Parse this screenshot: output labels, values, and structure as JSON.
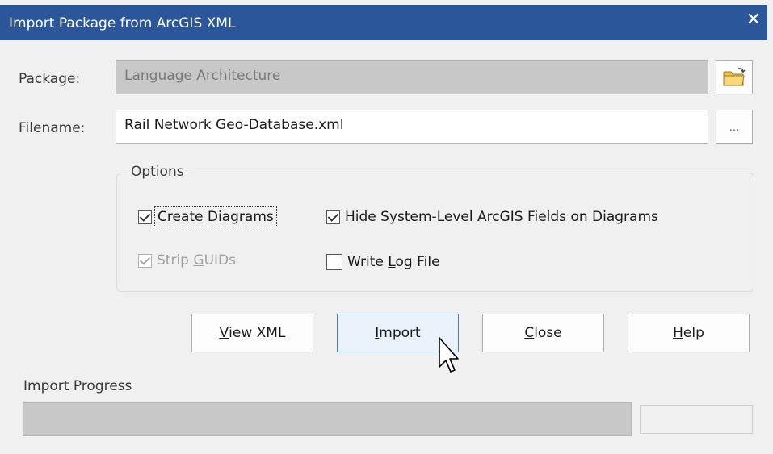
{
  "window": {
    "title": "Import Package from ArcGIS XML",
    "close_glyph": "✕"
  },
  "package": {
    "label": "Package:",
    "value": "Language Architecture",
    "browse_icon": "folder-icon"
  },
  "filename": {
    "label": "Filename:",
    "value": "Rail Network Geo-Database.xml",
    "browse_label": "..."
  },
  "options": {
    "label": "Options",
    "create_diagrams": {
      "pre": "",
      "acc": "",
      "post": "Create Diagrams",
      "checked": true,
      "enabled": true
    },
    "hide_fields": {
      "pre": "Hide System-Level ArcGIS Fields on Diagrams",
      "checked": true,
      "enabled": true
    },
    "strip_guids": {
      "pre": "Strip ",
      "acc": "G",
      "post": "UIDs",
      "checked": true,
      "enabled": false
    },
    "write_log": {
      "pre": "Write ",
      "acc": "L",
      "post": "og File",
      "checked": false,
      "enabled": true
    }
  },
  "buttons": {
    "view_xml": {
      "acc": "V",
      "rest": "iew XML"
    },
    "import": {
      "acc": "I",
      "rest": "mport"
    },
    "close": {
      "acc": "C",
      "rest": "lose"
    },
    "help": {
      "acc": "H",
      "rest": "elp"
    }
  },
  "progress": {
    "label": "Import Progress",
    "value": 0
  }
}
